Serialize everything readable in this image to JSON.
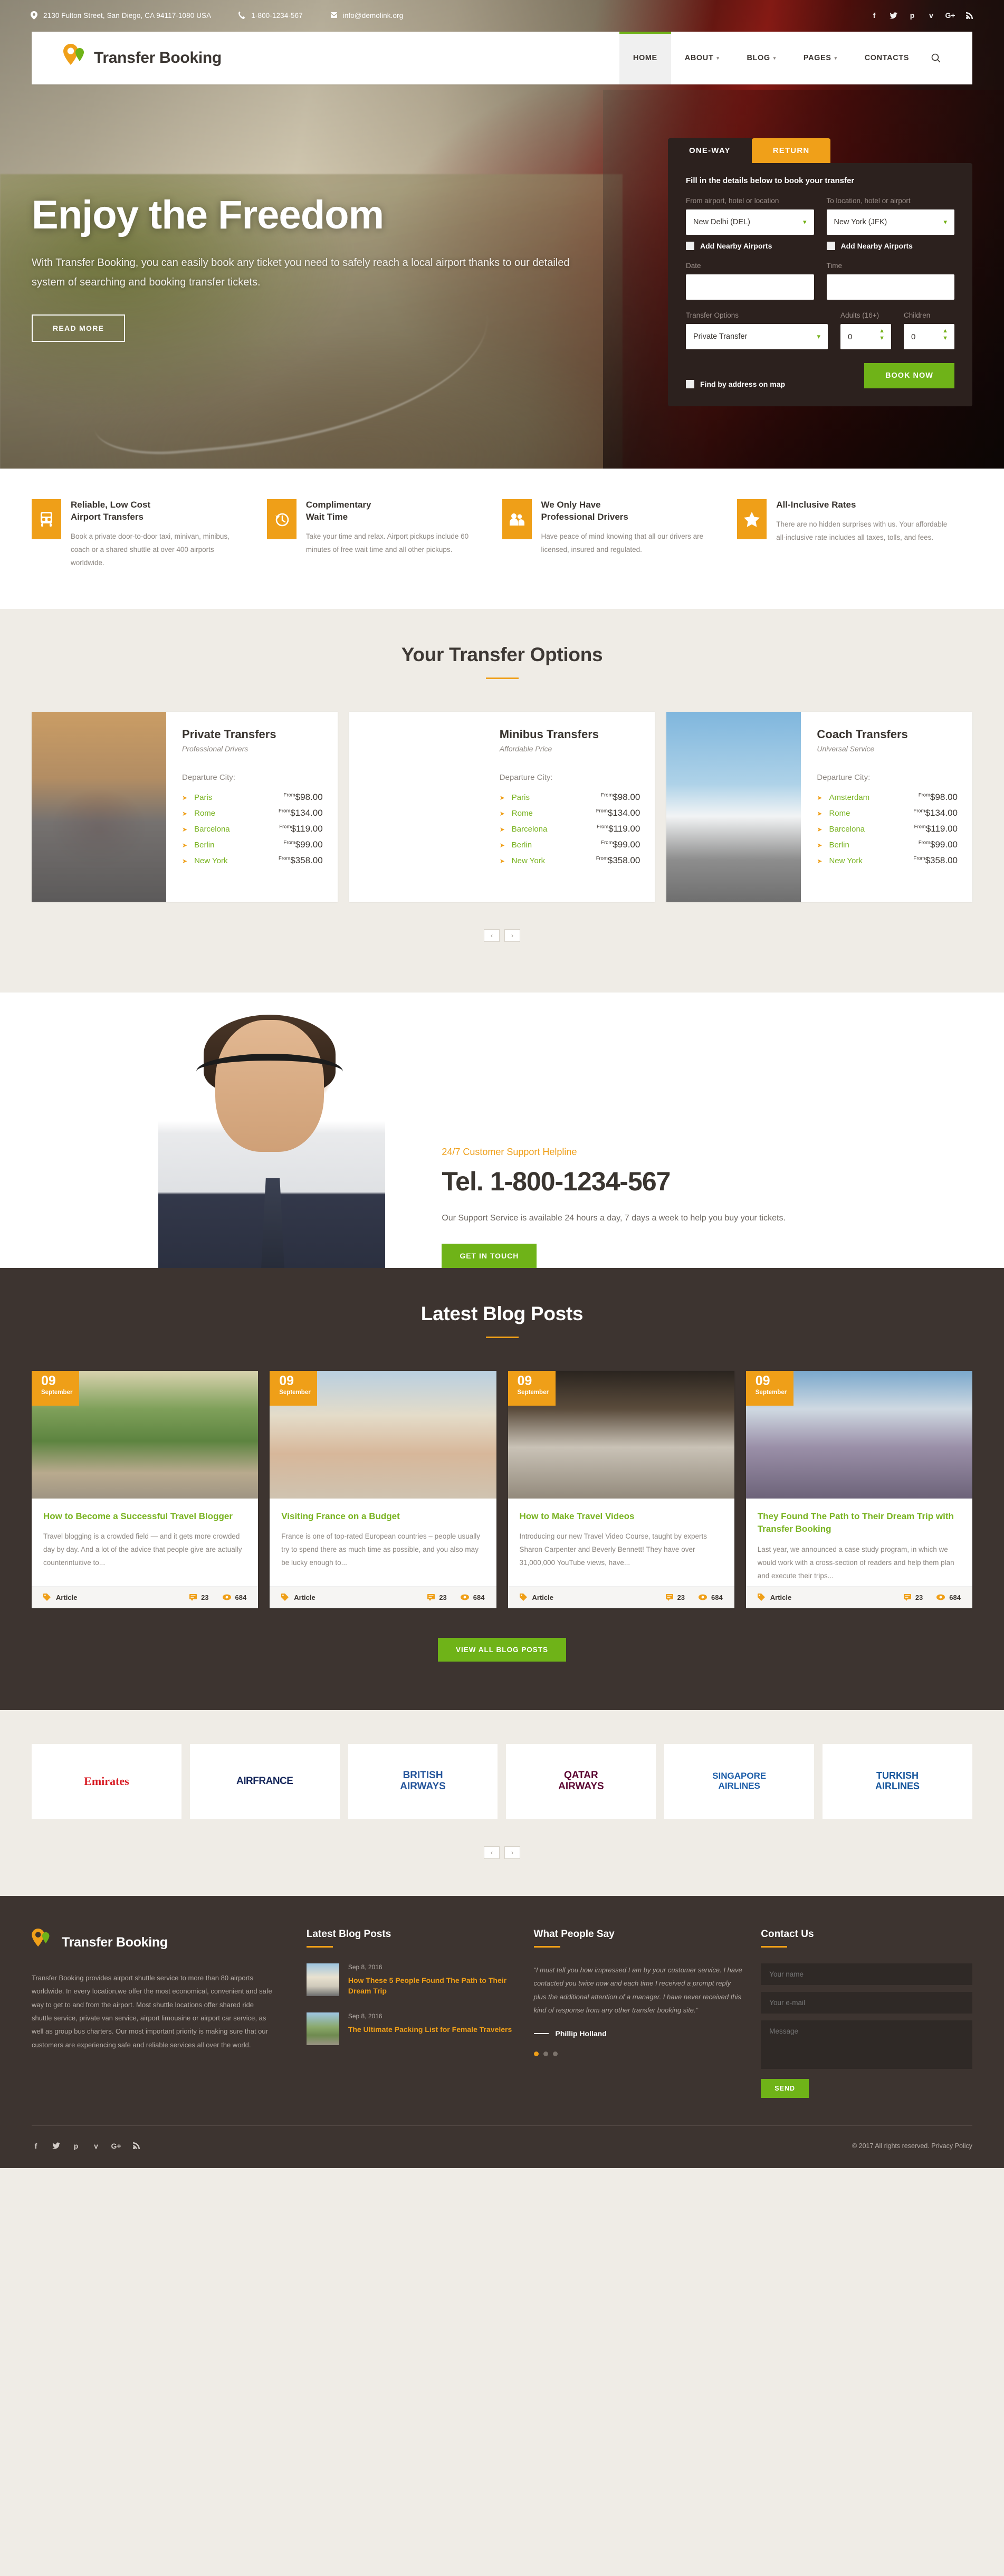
{
  "topbar": {
    "address": "2130 Fulton Street, San Diego, CA 94117-1080 USA",
    "phone": "1-800-1234-567",
    "email": "info@demolink.org",
    "socials": [
      "facebook-icon",
      "twitter-icon",
      "pinterest-icon",
      "vimeo-icon",
      "google-plus-icon",
      "rss-icon"
    ]
  },
  "nav": {
    "brand": "Transfer Booking",
    "items": [
      {
        "label": "HOME",
        "has_caret": false,
        "active": true
      },
      {
        "label": "ABOUT",
        "has_caret": true,
        "active": false
      },
      {
        "label": "BLOG",
        "has_caret": true,
        "active": false
      },
      {
        "label": "PAGES",
        "has_caret": true,
        "active": false
      },
      {
        "label": "CONTACTS",
        "has_caret": false,
        "active": false
      }
    ],
    "search_label": "search-icon"
  },
  "hero": {
    "heading": "Enjoy the Freedom",
    "paragraph": "With Transfer Booking, you can easily book any ticket you need to safely reach a local airport thanks to our detailed system of searching and booking transfer tickets.",
    "button": "READ MORE"
  },
  "booking": {
    "tabs": [
      {
        "label": "ONE-WAY",
        "active": true
      },
      {
        "label": "RETURN",
        "active": false
      }
    ],
    "intro": "Fill in the details below to book your transfer",
    "from_label": "From airport, hotel or location",
    "from_value": "New Delhi (DEL)",
    "to_label": "To location, hotel or airport",
    "to_value": "New York (JFK)",
    "nearby_label": "Add Nearby Airports",
    "date_label": "Date",
    "date_value": "",
    "time_label": "Time",
    "time_value": "",
    "transfer_label": "Transfer Options",
    "transfer_value": "Private Transfer",
    "adults_label": "Adults (16+)",
    "adults_value": "0",
    "children_label": "Children",
    "children_value": "0",
    "map_label": "Find by address on map",
    "book_button": "BOOK NOW"
  },
  "features": [
    {
      "icon": "bus-icon",
      "title": "Reliable, Low Cost\nAirport Transfers",
      "desc": "Book a private door-to-door taxi, minivan, minibus, coach or a shared shuttle at over 400 airports worldwide."
    },
    {
      "icon": "clock-rewind-icon",
      "title": "Complimentary\nWait Time",
      "desc": "Take your time and relax. Airport pickups include 60 minutes of free wait time and all other pickups."
    },
    {
      "icon": "people-icon",
      "title": "We Only Have\nProfessional Drivers",
      "desc": "Have peace of mind knowing that all our drivers are licensed, insured and regulated."
    },
    {
      "icon": "star-icon",
      "title": "All-Inclusive Rates",
      "desc": "There are no hidden surprises with us. Your affordable all-inclusive rate includes all taxes, tolls, and fees."
    }
  ],
  "options": {
    "title": "Your Transfer Options",
    "departure_label": "Departure City:",
    "from_prefix": "From",
    "prev": "‹",
    "next": "›",
    "cards": [
      {
        "img": "car",
        "title": "Private Transfers",
        "subtitle": "Professional Drivers",
        "rows": [
          {
            "city": "Paris",
            "price": "$98.00"
          },
          {
            "city": "Rome",
            "price": "$134.00"
          },
          {
            "city": "Barcelona",
            "price": "$119.00"
          },
          {
            "city": "Berlin",
            "price": "$99.00"
          },
          {
            "city": "New York",
            "price": "$358.00"
          }
        ]
      },
      {
        "img": "van",
        "title": "Minibus Transfers",
        "subtitle": "Affordable Price",
        "rows": [
          {
            "city": "Paris",
            "price": "$98.00"
          },
          {
            "city": "Rome",
            "price": "$134.00"
          },
          {
            "city": "Barcelona",
            "price": "$119.00"
          },
          {
            "city": "Berlin",
            "price": "$99.00"
          },
          {
            "city": "New York",
            "price": "$358.00"
          }
        ]
      },
      {
        "img": "coach",
        "title": "Coach Transfers",
        "subtitle": "Universal Service",
        "rows": [
          {
            "city": "Amsterdam",
            "price": "$98.00"
          },
          {
            "city": "Rome",
            "price": "$134.00"
          },
          {
            "city": "Barcelona",
            "price": "$119.00"
          },
          {
            "city": "Berlin",
            "price": "$99.00"
          },
          {
            "city": "New York",
            "price": "$358.00"
          }
        ]
      }
    ]
  },
  "support": {
    "kicker": "24/7 Customer Support Helpline",
    "tel": "Tel. 1-800-1234-567",
    "desc": "Our Support Service is available 24 hours a day, 7 days a week to help you buy your tickets.",
    "button": "GET IN TOUCH"
  },
  "blog": {
    "title": "Latest Blog Posts",
    "tag_label": "Article",
    "view_all": "VIEW ALL BLOG POSTS",
    "posts": [
      {
        "img": "a",
        "day": "09",
        "month": "September",
        "title": "How to Become a Successful Travel Blogger",
        "excerpt": "Travel blogging is a crowded field — and it gets more crowded day by day. And a lot of the advice that people give are actually counterintuitive to...",
        "comments": "23",
        "views": "684"
      },
      {
        "img": "b",
        "day": "09",
        "month": "September",
        "title": "Visiting France on a Budget",
        "excerpt": "France is one of top-rated European countries – people usually try to spend there as much time as possible, and you also may be lucky enough to...",
        "comments": "23",
        "views": "684"
      },
      {
        "img": "c",
        "day": "09",
        "month": "September",
        "title": "How to Make Travel Videos",
        "excerpt": "Introducing our new Travel Video Course, taught by experts Sharon Carpenter and Beverly Bennett! They have over 31,000,000 YouTube views, have...",
        "comments": "23",
        "views": "684"
      },
      {
        "img": "d",
        "day": "09",
        "month": "September",
        "title": "They Found The Path to Their Dream Trip with Transfer Booking",
        "excerpt": "Last year, we announced a case study program, in which we would work with a cross-section of readers and help them plan and execute their trips...",
        "comments": "23",
        "views": "684"
      }
    ]
  },
  "partners": {
    "prev": "‹",
    "next": "›",
    "logos": [
      {
        "name": "Emirates",
        "color": "#d71921"
      },
      {
        "name": "AIRFRANCE",
        "color": "#17285c"
      },
      {
        "name": "BRITISH\nAIRWAYS",
        "color": "#25559b"
      },
      {
        "name": "QATAR\nAIRWAYS",
        "color": "#5c0632"
      },
      {
        "name": "SINGAPORE\nAIRLINES",
        "color": "#1a5ca8"
      },
      {
        "name": "TURKISH\nAIRLINES",
        "color": "#15559c"
      }
    ]
  },
  "footer": {
    "brand": "Transfer Booking",
    "about": "Transfer Booking provides airport shuttle service to more than 80 airports worldwide. In every location,we offer the most economical, convenient and safe way to get to and from the airport. Most shuttle locations offer shared ride shuttle service, private van service, airport limousine or airport car service, as well as group bus charters. Our most important priority is making sure that our customers are experiencing safe and reliable services all over the world.",
    "blog_title": "Latest Blog Posts",
    "blog_posts": [
      {
        "thumb": "t1",
        "date": "Sep 8, 2016",
        "title": "How These 5 People Found The Path to Their Dream Trip"
      },
      {
        "thumb": "t2",
        "date": "Sep 8, 2016",
        "title": "The Ultimate Packing List for Female Travelers"
      }
    ],
    "says_title": "What People Say",
    "quote": "“I must tell you how impressed I am by your customer service. I have contacted you twice now and each time I received a prompt reply plus the additional attention of a manager. I have never received this kind of response from any other transfer booking site.”",
    "author": "Phillip Holland",
    "contact_title": "Contact Us",
    "name_placeholder": "Your name",
    "email_placeholder": "Your e-mail",
    "message_placeholder": "Message",
    "send": "SEND",
    "copyright": "© 2017 All rights reserved. Privacy Policy",
    "socials": [
      "facebook-icon",
      "twitter-icon",
      "pinterest-icon",
      "vimeo-icon",
      "google-plus-icon",
      "rss-icon"
    ]
  }
}
